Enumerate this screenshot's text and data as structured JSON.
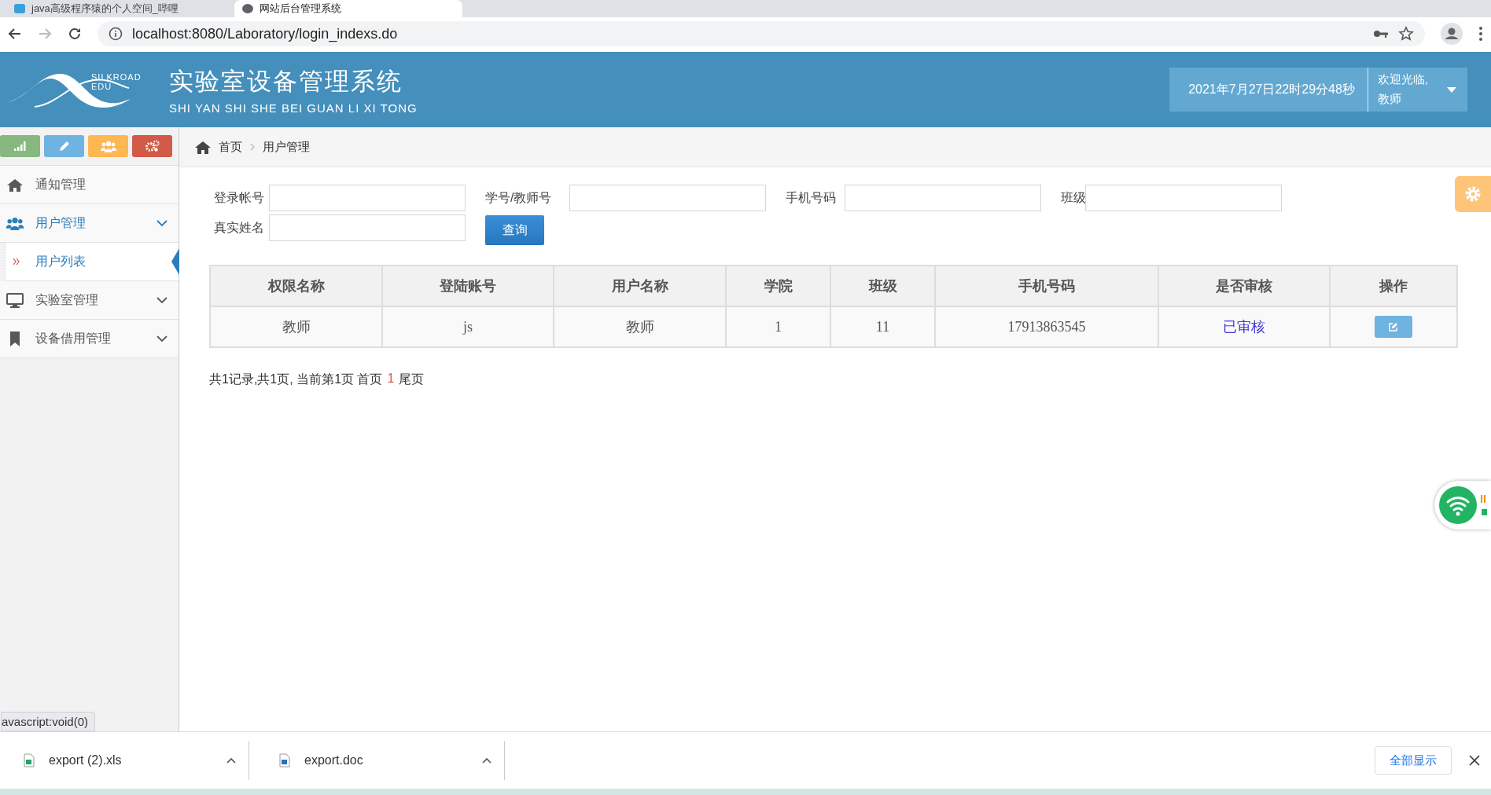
{
  "browser": {
    "tabs": [
      {
        "title": "java高级程序猿的个人空间_哔哩",
        "selected": false
      },
      {
        "title": "网站后台管理系统",
        "selected": true
      }
    ],
    "address": "localhost:8080/Laboratory/login_indexs.do"
  },
  "header": {
    "logo_text": "SILKROAD EDU",
    "title": "实验室设备管理系统",
    "subtitle": "SHI YAN SHI SHE BEI GUAN LI XI TONG",
    "datetime": "2021年7月27日22时29分48秒",
    "welcome": "欢迎光临,",
    "user": "教师"
  },
  "sidebar": {
    "shortcuts": [
      {
        "kind": "signal",
        "color": "#87b87f"
      },
      {
        "kind": "pencil",
        "color": "#6fb3e0"
      },
      {
        "kind": "users",
        "color": "#ffb752"
      },
      {
        "kind": "gears",
        "color": "#d15b47"
      }
    ],
    "menu": [
      {
        "label": "通知管理",
        "kind": "home",
        "has_submenu": false,
        "active": false
      },
      {
        "label": "用户管理",
        "kind": "users",
        "has_submenu": true,
        "active": true,
        "children": [
          {
            "label": "用户列表",
            "selected": true
          }
        ]
      },
      {
        "label": "实验室管理",
        "kind": "monitor",
        "has_submenu": true,
        "active": false
      },
      {
        "label": "设备借用管理",
        "kind": "bookmark",
        "has_submenu": true,
        "active": false
      }
    ]
  },
  "breadcrumb": [
    "首页",
    "用户管理"
  ],
  "filters": [
    {
      "label": "登录帐号"
    },
    {
      "label": "学号/教师号"
    },
    {
      "label": "手机号码"
    },
    {
      "label": "班级"
    },
    {
      "label": "真实姓名"
    }
  ],
  "search_button": "查询",
  "table": {
    "columns": [
      "权限名称",
      "登陆账号",
      "用户名称",
      "学院",
      "班级",
      "手机号码",
      "是否审核",
      "操作"
    ],
    "rows": [
      {
        "cells": [
          "教师",
          "js",
          "教师",
          "1",
          "11",
          "17913863545"
        ],
        "status": "已审核"
      }
    ]
  },
  "pagination": {
    "summary": "共1记录,共1页, 当前第1页 首页",
    "current": "1",
    "last": "尾页"
  },
  "status_url": "avascript:void(0)",
  "downloads": [
    {
      "name": "export (2).xls",
      "kind": "xls"
    },
    {
      "name": "export.doc",
      "kind": "doc"
    }
  ],
  "show_all": "全部显示"
}
